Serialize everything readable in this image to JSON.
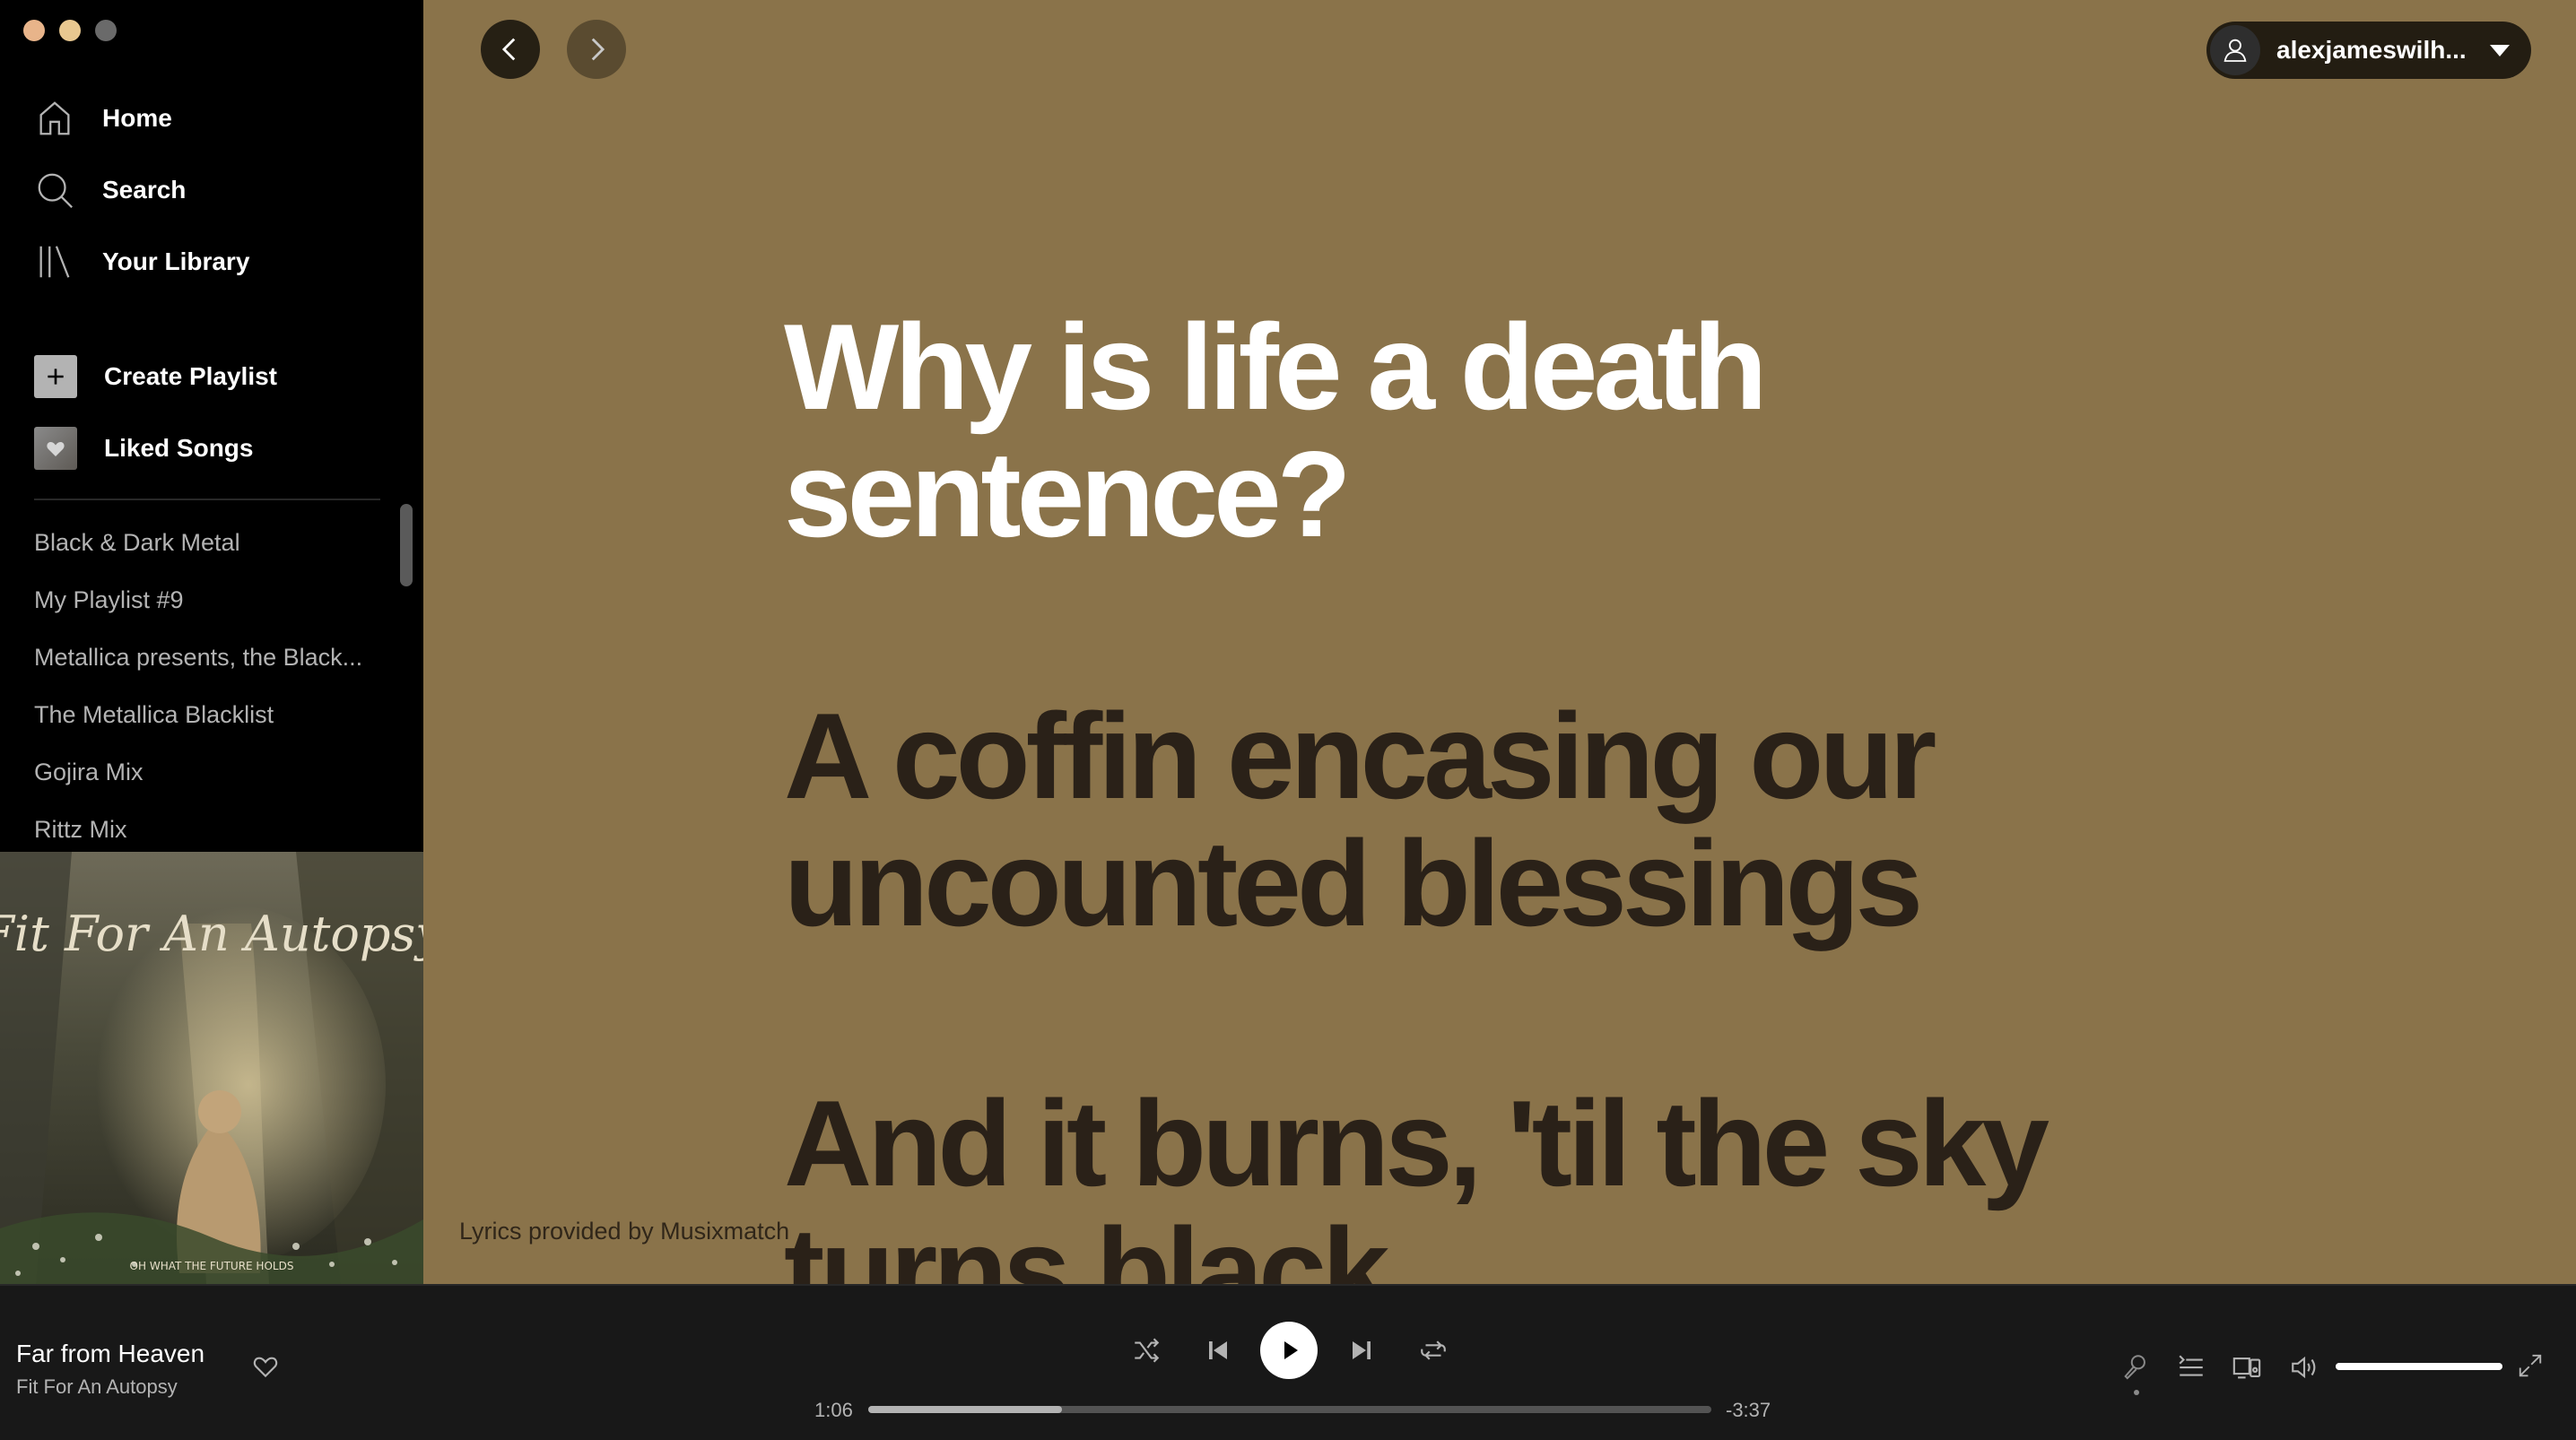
{
  "colors": {
    "background_main": "#8a734a",
    "lyric_active": "#ffffff",
    "lyric_upcoming": "#2a2118",
    "sidebar": "#000000",
    "player_bar": "#181818"
  },
  "window_controls": [
    "close",
    "minimize",
    "maximize"
  ],
  "sidebar": {
    "nav": [
      {
        "label": "Home",
        "icon": "home-icon"
      },
      {
        "label": "Search",
        "icon": "search-icon"
      },
      {
        "label": "Your Library",
        "icon": "library-icon"
      }
    ],
    "actions": [
      {
        "label": "Create Playlist",
        "icon": "plus-icon"
      },
      {
        "label": "Liked Songs",
        "icon": "heart-icon"
      }
    ],
    "playlists": [
      "Black & Dark Metal",
      "My Playlist #9",
      "Metallica presents, the Black...",
      "The Metallica Blacklist",
      "Gojira Mix",
      "Rittz Mix"
    ],
    "album_art": {
      "band_logo_text": "Fit For An Autopsy",
      "album_title_text": "OH WHAT THE FUTURE HOLDS"
    }
  },
  "header": {
    "back_icon": "chevron-left-icon",
    "forward_icon": "chevron-right-icon",
    "user": {
      "name": "alexjameswilh...",
      "icon": "user-icon",
      "caret": "caret-down-icon"
    }
  },
  "lyrics": {
    "lines": [
      {
        "line1": "Why is life a death",
        "line2": "sentence?",
        "active": true
      },
      {
        "line1": "A coffin encasing our",
        "line2": "uncounted blessings",
        "active": false
      },
      {
        "line1": "And it burns, 'til the sky",
        "line2": "turns black",
        "active": false
      }
    ],
    "credit": "Lyrics provided by Musixmatch"
  },
  "player": {
    "track_title": "Far from Heaven",
    "track_artist": "Fit For An Autopsy",
    "elapsed": "1:06",
    "remaining": "-3:37",
    "progress_fraction": 0.23,
    "volume_fraction": 1.0,
    "controls": [
      "shuffle-icon",
      "previous-icon",
      "play-icon",
      "next-icon",
      "repeat-icon"
    ],
    "right_controls": [
      "lyrics-icon",
      "queue-icon",
      "devices-icon",
      "volume-icon",
      "fullscreen-icon"
    ]
  }
}
